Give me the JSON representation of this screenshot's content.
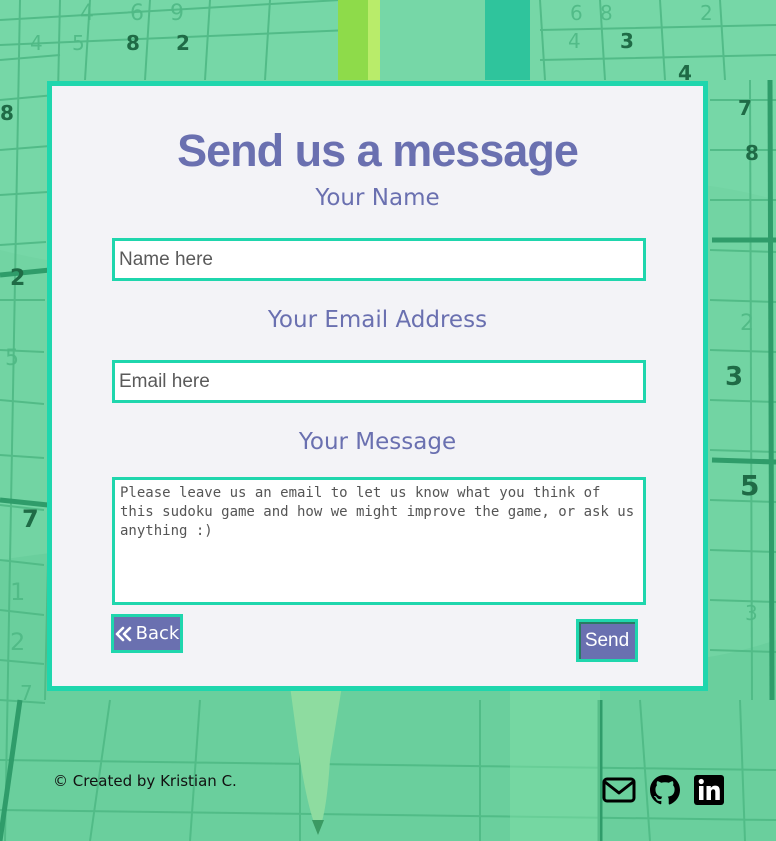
{
  "form": {
    "title": "Send us a message",
    "name_label": "Your Name",
    "name_placeholder": "Name here",
    "email_label": "Your Email Address",
    "email_placeholder": "Email here",
    "message_label": "Your Message",
    "message_placeholder": "Please leave us an email to let us know what you think of this sudoku game and how we might improve the game, or ask us anything :)",
    "back_label": "Back",
    "send_label": "Send"
  },
  "footer": {
    "credit": "© Created by Kristian C.",
    "social_icons": [
      "envelope-icon",
      "github-icon",
      "linkedin-icon"
    ]
  },
  "colors": {
    "accent": "#1fd6ad",
    "brand": "#6a70b0",
    "card_bg": "#f3f3f7",
    "page_bg": "#6fd3a0"
  },
  "background": {
    "sudoku_digits": [
      "4",
      "5",
      "8",
      "2",
      "6",
      "9",
      "3",
      "2",
      "5",
      "8",
      "4",
      "3",
      "7",
      "7",
      "5",
      "8",
      "3",
      "2",
      "5",
      "6",
      "4",
      "1",
      "2",
      "3"
    ]
  }
}
